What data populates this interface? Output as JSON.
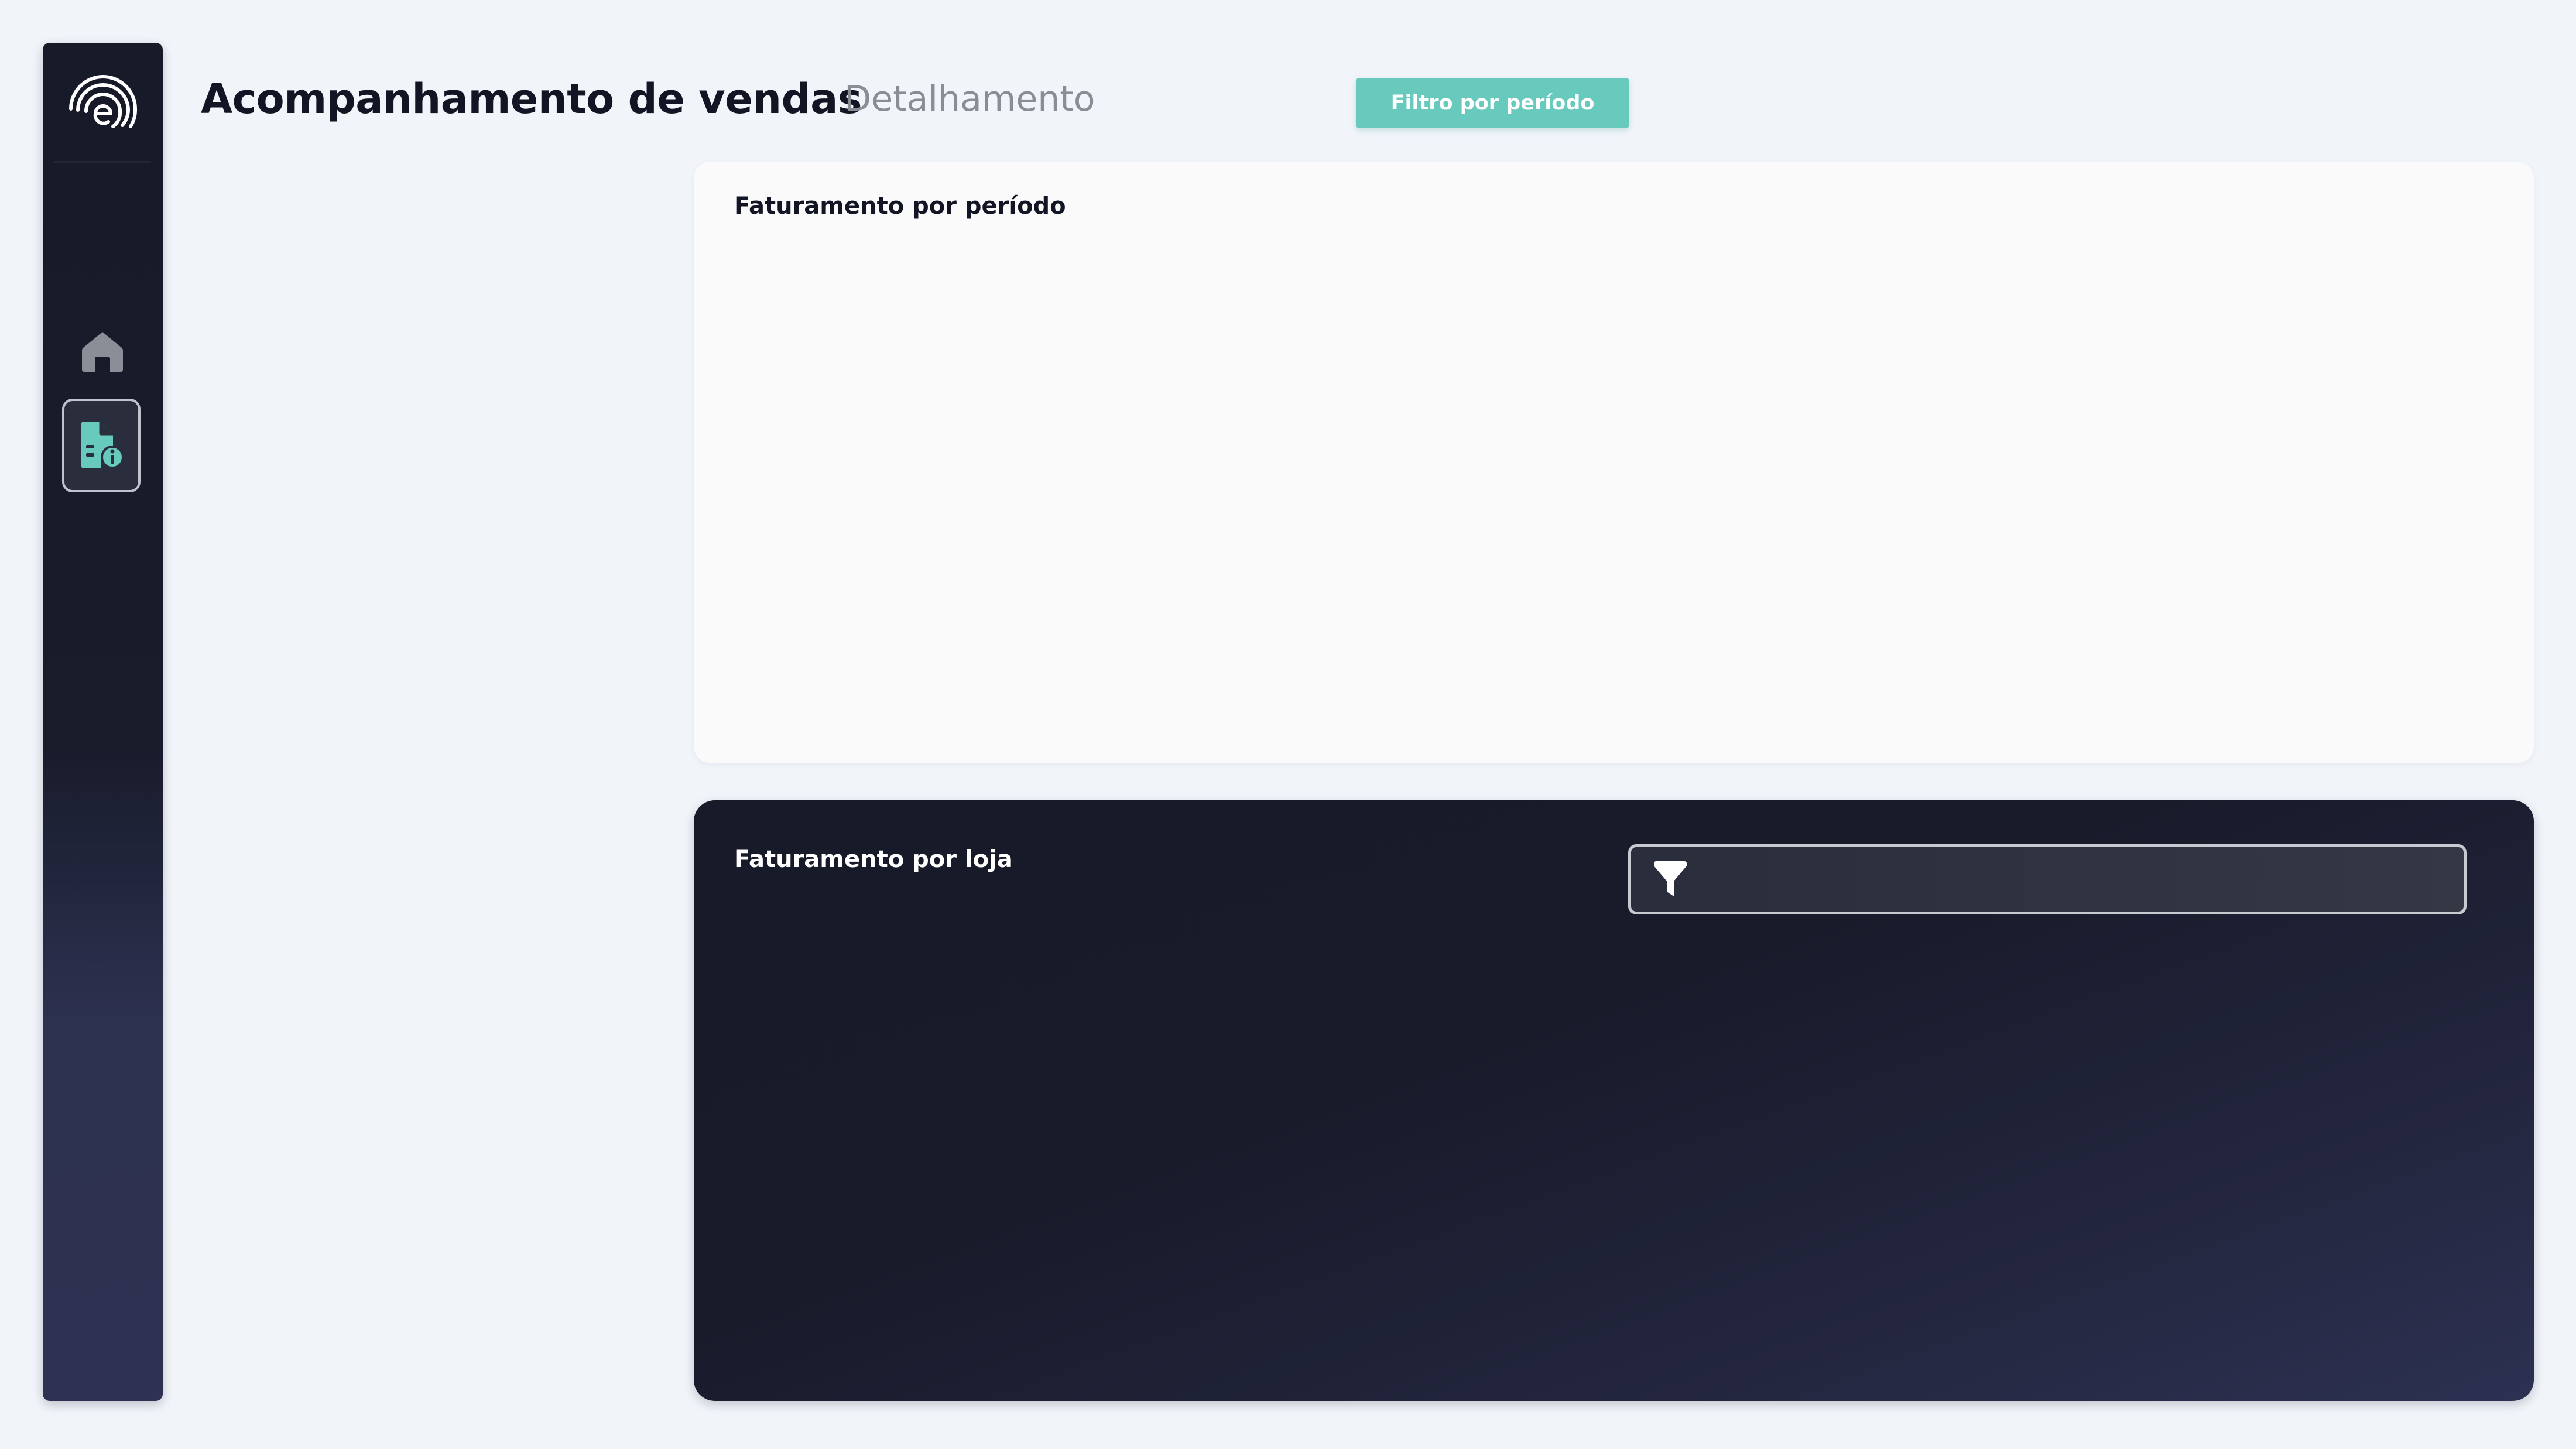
{
  "header": {
    "title": "Acompanhamento de vendas",
    "subtitle": "Detalhamento",
    "period_filter_label": "Filtro por período"
  },
  "sidebar": {
    "logo_icon": "brand-logo-icon",
    "items": [
      {
        "icon": "home-icon",
        "active": false
      },
      {
        "icon": "document-info-icon",
        "active": true
      }
    ]
  },
  "cards": {
    "period": {
      "title": "Faturamento por período"
    },
    "store": {
      "title": "Faturamento por loja",
      "filter_value": "",
      "filter_icon": "filter-icon"
    }
  },
  "colors": {
    "accent": "#68c9bd",
    "dark": "#171a28",
    "background": "#f1f5fa"
  }
}
